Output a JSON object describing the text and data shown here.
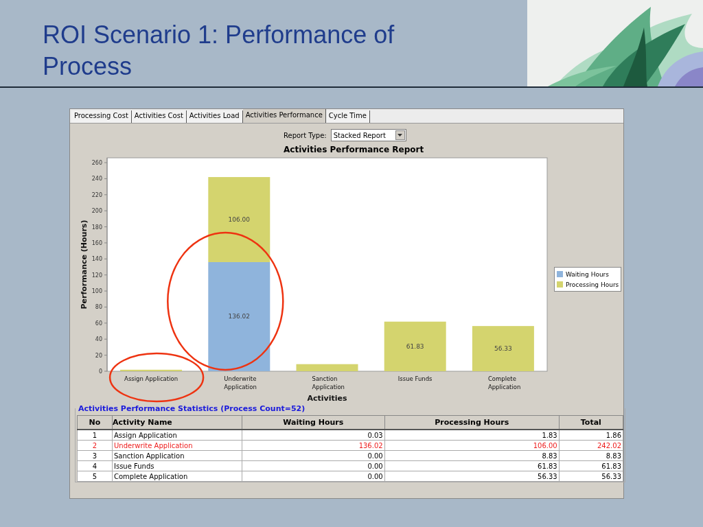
{
  "slide": {
    "title": "ROI Scenario 1: Performance of Process"
  },
  "tabs": [
    {
      "label": "Processing Cost",
      "selected": false
    },
    {
      "label": "Activities Cost",
      "selected": false
    },
    {
      "label": "Activities Load",
      "selected": false
    },
    {
      "label": "Activities Performance",
      "selected": true
    },
    {
      "label": "Cycle Time",
      "selected": false
    }
  ],
  "report_type": {
    "label": "Report Type:",
    "value": "Stacked Report"
  },
  "chart": {
    "circled": [
      true,
      true,
      false,
      false,
      false
    ],
    "chart_data": {
      "type": "bar",
      "title": "Activities Performance Report",
      "xlabel": "Activities",
      "ylabel": "Performance (Hours)",
      "stacked": true,
      "orientation": "vertical",
      "value_labels": [
        [
          null,
          "136.02",
          null,
          null,
          null
        ],
        [
          null,
          "106.00",
          null,
          "61.83",
          "56.33"
        ]
      ],
      "categories": [
        "Assign Application",
        "Underwrite Application",
        "Sanction Application",
        "Issue Funds",
        "Complete Application"
      ],
      "series": [
        {
          "name": "Waiting Hours",
          "color": "#8fb4dc",
          "values": [
            0.03,
            136.02,
            0,
            0,
            0
          ]
        },
        {
          "name": "Processing Hours",
          "color": "#d4d46e",
          "values": [
            1.83,
            106.0,
            8.83,
            61.83,
            56.33
          ]
        }
      ],
      "ylim": [
        0,
        266
      ],
      "yticks": [
        0,
        20,
        40,
        60,
        80,
        100,
        120,
        140,
        160,
        180,
        200,
        220,
        240,
        260
      ]
    }
  },
  "statistics": {
    "title": "Activities Performance Statistics (Process Count=52)",
    "columns": [
      "No",
      "Activity Name",
      "Waiting Hours",
      "Processing Hours",
      "Total"
    ],
    "rows": [
      {
        "cells": [
          "1",
          "Assign Application",
          "0.03",
          "1.83",
          "1.86"
        ],
        "highlighted": false
      },
      {
        "cells": [
          "2",
          "Underwrite Application",
          "136.02",
          "106.00",
          "242.02"
        ],
        "highlighted": true
      },
      {
        "cells": [
          "3",
          "Sanction Application",
          "0.00",
          "8.83",
          "8.83"
        ],
        "highlighted": false
      },
      {
        "cells": [
          "4",
          "Issue Funds",
          "0.00",
          "61.83",
          "61.83"
        ],
        "highlighted": false
      },
      {
        "cells": [
          "5",
          "Complete Application",
          "0.00",
          "56.33",
          "56.33"
        ],
        "highlighted": false
      }
    ]
  }
}
